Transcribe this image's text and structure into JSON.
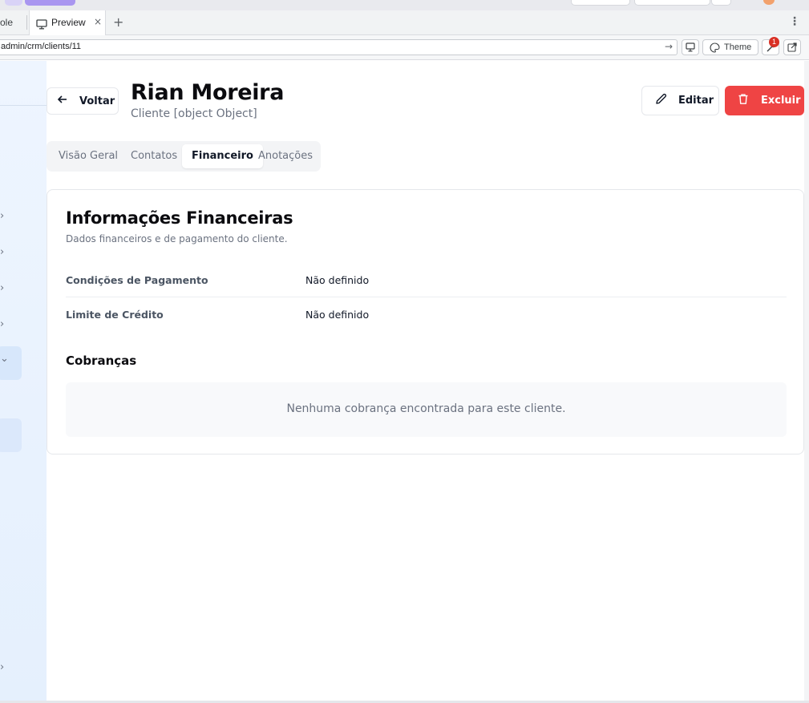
{
  "browser": {
    "partial_tab_label": "ole",
    "active_tab_label": "Preview",
    "tab_close_glyph": "×",
    "new_tab_glyph": "+",
    "menu_glyph": "⋮",
    "url": "admin/crm/clients/11",
    "go_glyph": "→",
    "theme_label": "Theme",
    "notification_count": "1"
  },
  "sidebar": {
    "chevrons": [
      "›",
      "›",
      "›",
      "›",
      "⌄",
      "›"
    ]
  },
  "header": {
    "back_label": "Voltar",
    "title": "Rian Moreira",
    "subtitle": "Cliente [object Object]",
    "edit_label": "Editar",
    "delete_label": "Excluir",
    "delete_color": "#ef4444"
  },
  "tabs": [
    {
      "label": "Visão Geral",
      "active": false
    },
    {
      "label": "Contatos",
      "active": false
    },
    {
      "label": "Financeiro",
      "active": true
    },
    {
      "label": "Anotações",
      "active": false
    }
  ],
  "financial": {
    "title": "Informações Financeiras",
    "description": "Dados financeiros e de pagamento do cliente.",
    "rows": [
      {
        "label": "Condições de Pagamento",
        "value": "Não definido"
      },
      {
        "label": "Limite de Crédito",
        "value": "Não definido"
      }
    ],
    "charges_title": "Cobranças",
    "charges_empty": "Nenhuma cobrança encontrada para este cliente."
  },
  "icons": {
    "back": "arrow-left-icon",
    "edit": "pencil-icon",
    "delete": "trash-icon",
    "preview_tab": "monitor-icon",
    "theme": "palette-icon"
  }
}
